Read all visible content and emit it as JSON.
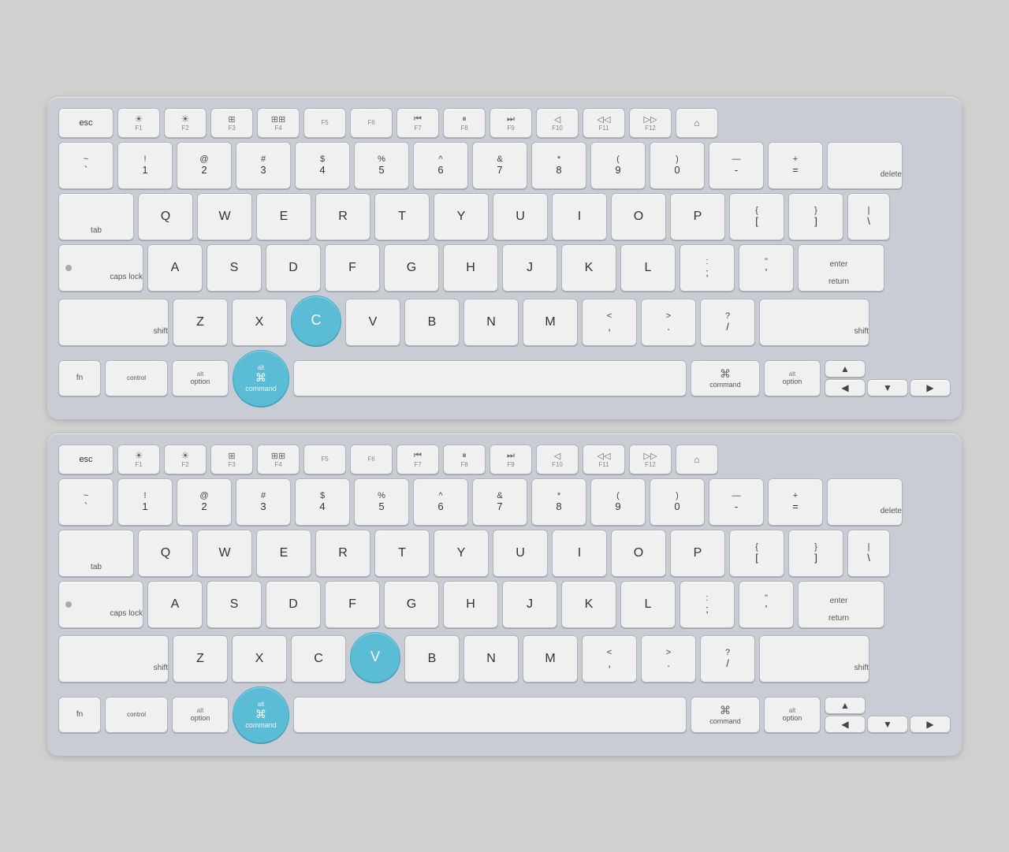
{
  "keyboards": [
    {
      "id": "keyboard-1",
      "highlighted_keys": [
        "C",
        "command-left"
      ],
      "fn_row": [
        "esc",
        "F1",
        "F2",
        "F3",
        "F4",
        "F5",
        "F6",
        "F7",
        "F8",
        "F9",
        "F10",
        "F11",
        "F12",
        "⌂"
      ],
      "number_row": [
        {
          "sym": "~",
          "key": "`"
        },
        {
          "sym": "!",
          "key": "1"
        },
        {
          "sym": "@",
          "key": "2"
        },
        {
          "sym": "#",
          "key": "3"
        },
        {
          "sym": "$",
          "key": "4"
        },
        {
          "sym": "%",
          "key": "5"
        },
        {
          "sym": "^",
          "key": "6"
        },
        {
          "sym": "&",
          "key": "7"
        },
        {
          "sym": "*",
          "key": "8"
        },
        {
          "sym": "(",
          "key": "9"
        },
        {
          "sym": ")",
          "key": "0"
        },
        {
          "sym": "—",
          "key": "-"
        },
        {
          "sym": "+",
          "key": "="
        }
      ],
      "qwerty_row": [
        "Q",
        "W",
        "E",
        "R",
        "T",
        "Y",
        "U",
        "I",
        "O",
        "P"
      ],
      "asdf_row": [
        "A",
        "S",
        "D",
        "F",
        "G",
        "H",
        "J",
        "K",
        "L"
      ],
      "zxcv_row": [
        "Z",
        "X",
        "C",
        "V",
        "B",
        "N",
        "M"
      ],
      "bottom_row_labels": {
        "fn": "fn",
        "control": "control",
        "option_left": "option",
        "command_left": "command",
        "command_right": "command",
        "option_right": "option"
      }
    },
    {
      "id": "keyboard-2",
      "highlighted_keys": [
        "V",
        "command-left"
      ],
      "fn_row": [
        "esc",
        "F1",
        "F2",
        "F3",
        "F4",
        "F5",
        "F6",
        "F7",
        "F8",
        "F9",
        "F10",
        "F11",
        "F12",
        "⌂"
      ],
      "number_row": [
        {
          "sym": "~",
          "key": "`"
        },
        {
          "sym": "!",
          "key": "1"
        },
        {
          "sym": "@",
          "key": "2"
        },
        {
          "sym": "#",
          "key": "3"
        },
        {
          "sym": "$",
          "key": "4"
        },
        {
          "sym": "%",
          "key": "5"
        },
        {
          "sym": "^",
          "key": "6"
        },
        {
          "sym": "&",
          "key": "7"
        },
        {
          "sym": "*",
          "key": "8"
        },
        {
          "sym": "(",
          "key": "9"
        },
        {
          "sym": ")",
          "key": "0"
        },
        {
          "sym": "—",
          "key": "-"
        },
        {
          "sym": "+",
          "key": "="
        }
      ],
      "qwerty_row": [
        "Q",
        "W",
        "E",
        "R",
        "T",
        "Y",
        "U",
        "I",
        "O",
        "P"
      ],
      "asdf_row": [
        "A",
        "S",
        "D",
        "F",
        "G",
        "H",
        "J",
        "K",
        "L"
      ],
      "zxcv_row": [
        "Z",
        "X",
        "C",
        "V",
        "B",
        "N",
        "M"
      ],
      "bottom_row_labels": {
        "fn": "fn",
        "control": "control",
        "option_left": "option",
        "command_left": "command",
        "command_right": "command",
        "option_right": "option"
      }
    }
  ],
  "accent": "#5bbcd6",
  "bg": "#d0d3d9"
}
